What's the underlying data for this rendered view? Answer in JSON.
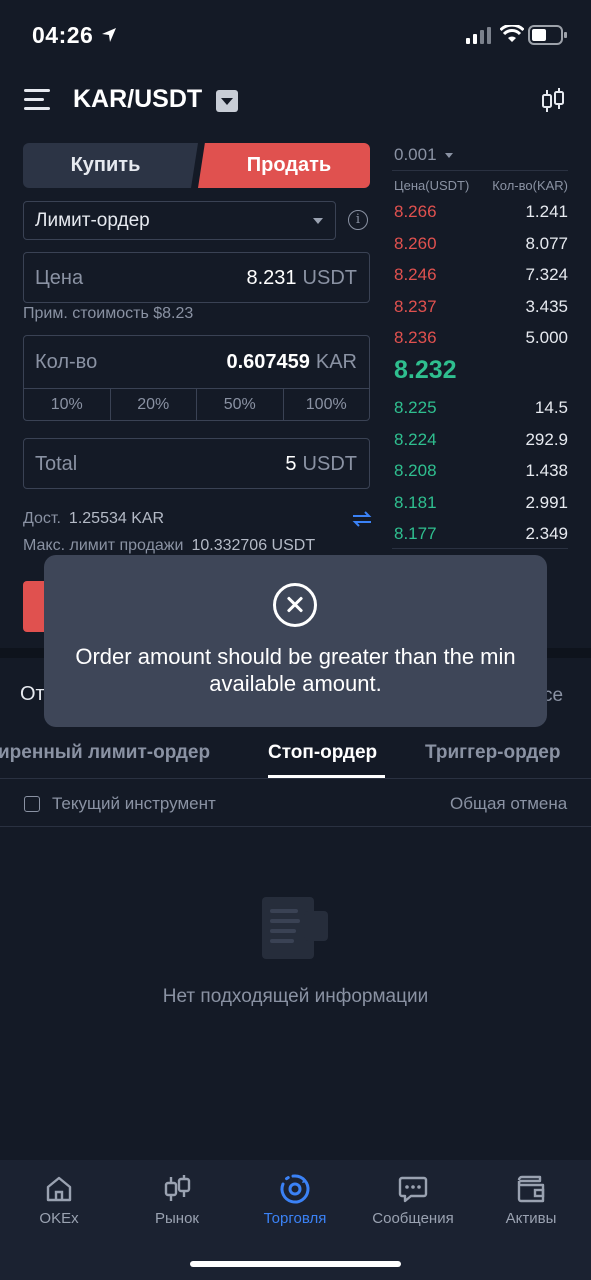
{
  "status_bar": {
    "time": "04:26"
  },
  "header": {
    "pair": "KAR/USDT"
  },
  "trade": {
    "buy_label": "Купить",
    "sell_label": "Продать",
    "order_type": "Лимит-ордер",
    "price": {
      "label": "Цена",
      "value": "8.231",
      "unit": "USDT"
    },
    "approx_value": "Прим. стоимость $8.23",
    "quantity": {
      "label": "Кол-во",
      "value": "0.607459",
      "unit": "KAR"
    },
    "percents": [
      "10%",
      "20%",
      "50%",
      "100%"
    ],
    "total": {
      "label": "Total",
      "value": "5",
      "unit": "USDT"
    },
    "available": {
      "label": "Дост.",
      "value": "1.25534 KAR"
    },
    "max_sell": {
      "label": "Макс. лимит продажи",
      "value": "10.332706 USDT"
    }
  },
  "order_book": {
    "step": "0.001",
    "price_header": "Цена(USDT)",
    "qty_header": "Кол-во(KAR)",
    "asks": [
      {
        "price": "8.266",
        "qty": "1.241"
      },
      {
        "price": "8.260",
        "qty": "8.077"
      },
      {
        "price": "8.246",
        "qty": "7.324"
      },
      {
        "price": "8.237",
        "qty": "3.435"
      },
      {
        "price": "8.236",
        "qty": "5.000"
      }
    ],
    "last_price": "8.232",
    "bids": [
      {
        "price": "8.225",
        "qty": "14.5"
      },
      {
        "price": "8.224",
        "qty": "292.9"
      },
      {
        "price": "8.208",
        "qty": "1.438"
      },
      {
        "price": "8.181",
        "qty": "2.991"
      },
      {
        "price": "8.177",
        "qty": "2.349"
      }
    ]
  },
  "orders": {
    "section_left": "От",
    "section_right": "се",
    "tabs": [
      "иренный лимит-ордер",
      "Стоп-ордер",
      "Триггер-ордер"
    ],
    "active_tab": "Стоп-ордер",
    "current_instrument": "Текущий инструмент",
    "cancel_all": "Общая отмена",
    "empty_text": "Нет подходящей информации"
  },
  "toast": {
    "message": "Order amount should be greater than the min available amount."
  },
  "nav": [
    {
      "label": "OKEx",
      "icon": "home-icon"
    },
    {
      "label": "Рынок",
      "icon": "candles-icon"
    },
    {
      "label": "Торговля",
      "icon": "trade-icon"
    },
    {
      "label": "Сообщения",
      "icon": "chat-icon"
    },
    {
      "label": "Активы",
      "icon": "wallet-icon"
    }
  ],
  "colors": {
    "sell": "#e0514f",
    "buy": "#2fbf8f",
    "accent": "#3b82f6",
    "background": "#141a26"
  }
}
